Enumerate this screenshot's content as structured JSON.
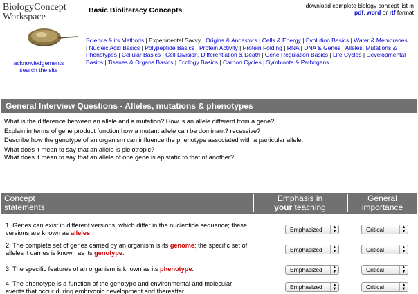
{
  "logo": {
    "line1": "BiologyConcept",
    "line2": "Workspace",
    "image": "horseshoe-crab-logo"
  },
  "left_links": {
    "acknowledgements": "acknowledgements",
    "search": "search the site"
  },
  "page_title": "Basic Bioliteracy Concepts",
  "download": {
    "text": "download complete  biology concept list in",
    "pdf": "pdf",
    "comma": ", ",
    "word": "word",
    "or": " or ",
    "rtf": "rtf",
    "format": " format"
  },
  "nav": {
    "items": [
      {
        "label": "Science & its Methods",
        "current": false
      },
      {
        "label": "Experimental Savvy",
        "current": true
      },
      {
        "label": "Origins & Ancestors",
        "current": false
      },
      {
        "label": "Cells & Energy",
        "current": false
      },
      {
        "label": "Evolution Basics",
        "current": false
      },
      {
        "label": "Water & Membranes",
        "current": false
      },
      {
        "label": "Nucleic Acid Basics",
        "current": false
      },
      {
        "label": "Polypeptide Basics",
        "current": false
      },
      {
        "label": "Protein Activity",
        "current": false
      },
      {
        "label": "Protein Folding",
        "current": false
      },
      {
        "label": "RNA",
        "current": false
      },
      {
        "label": "DNA & Genes",
        "current": false
      },
      {
        "label": "Alleles, Mutations & Phenotypes",
        "current": false
      },
      {
        "label": "Cellular Basics",
        "current": false
      },
      {
        "label": "Cell Division, Differentiation & Death",
        "current": false
      },
      {
        "label": "Gene Regulation Basics",
        "current": false
      },
      {
        "label": "Life Cycles",
        "current": false
      },
      {
        "label": "Developmental Basics",
        "current": false
      },
      {
        "label": "Tissues & Organs Basics",
        "current": false
      },
      {
        "label": "Ecology Basics",
        "current": false
      },
      {
        "label": "Carbon Cycles",
        "current": false
      },
      {
        "label": "Symbionts & Pathogens",
        "current": false
      }
    ]
  },
  "interview": {
    "heading": "General Interview Questions - Alleles, mutations & phenotypes",
    "questions": [
      "What is the difference between an allele and a mutation? How is an allele different from a gene?",
      "Explain in terms of gene product function how a mutant allele can be dominant? recessive?",
      "Describe how the genotype of an organism can influence the phenotype associated with a particular allele.",
      "What does it mean to say that an allele is pleiotropic?",
      "What does it mean to say that an allele of one gene is epistatic to that of another?"
    ]
  },
  "table": {
    "col_concept_line1": "Concept",
    "col_concept_line2": "statements",
    "col_emphasis_line1": "Emphasis in",
    "col_emphasis_strong": "your",
    "col_emphasis_rest": " teaching",
    "col_general_line1": "General",
    "col_general_line2": "importance",
    "rows": [
      {
        "pre": "1. Genes can exist in different versions, which differ in the nucleotide sequence; these versions are known as ",
        "term": "alleles",
        "post": ".",
        "emphasis": "Emphasized",
        "importance": "Critical"
      },
      {
        "pre": "2. The complete set of genes carried by an organism is its ",
        "term": "genome",
        "mid": "; the specific set of alleles it carries is known as its ",
        "term2": "genotype",
        "post": ".",
        "emphasis": "Emphasized",
        "importance": "Critical"
      },
      {
        "pre": "3. The specific features of an organism is known as its ",
        "term": "phenotype",
        "post": ".",
        "emphasis": "Emphasized",
        "importance": "Critical"
      },
      {
        "pre": "4. The phenotype is a function of the genotype and environmental and molecular events that occur during embryonic development and thereafter.",
        "emphasis": "Emphasized",
        "importance": "Critical"
      }
    ]
  }
}
